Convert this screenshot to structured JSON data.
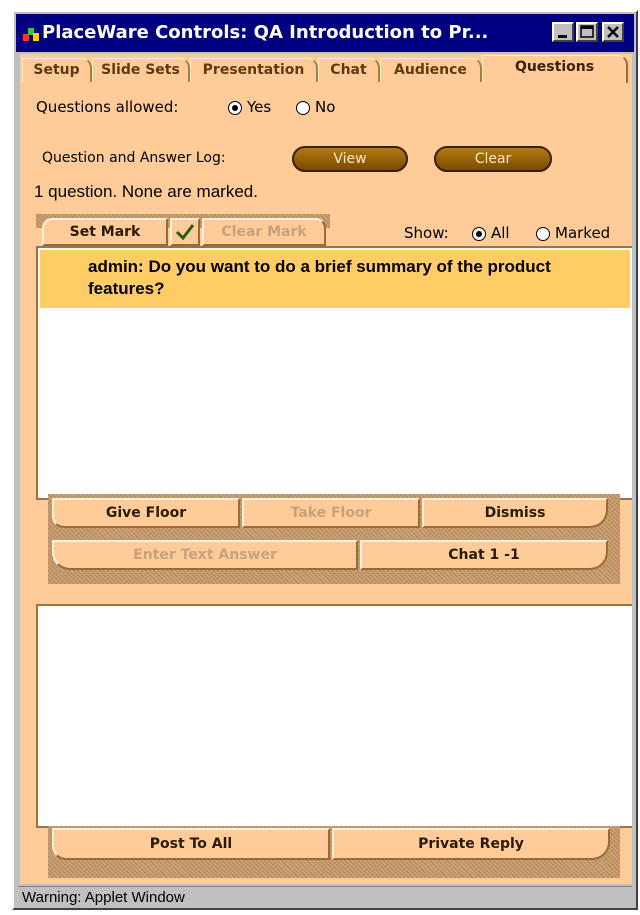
{
  "window": {
    "title": "PlaceWare Controls: QA  Introduction to Pr...",
    "icons": [
      "app-logo-icon",
      "minimize-icon",
      "maximize-icon",
      "close-icon"
    ]
  },
  "tabs": [
    {
      "label": "Setup",
      "active": false
    },
    {
      "label": "Slide Sets",
      "active": false
    },
    {
      "label": "Presentation",
      "active": false
    },
    {
      "label": "Chat",
      "active": false
    },
    {
      "label": "Audience",
      "active": false
    },
    {
      "label": "Questions",
      "active": true
    }
  ],
  "questions_allowed": {
    "label": "Questions allowed:",
    "options": [
      "Yes",
      "No"
    ],
    "selected": "Yes"
  },
  "qa_log": {
    "label": "Question and Answer Log:",
    "view_label": "View",
    "clear_label": "Clear"
  },
  "summary": "1 question. None are marked.",
  "marks": {
    "set_mark_label": "Set Mark",
    "clear_mark_label": "Clear Mark",
    "check_icon": "check-icon"
  },
  "show": {
    "label": "Show:",
    "options": [
      "All",
      "Marked"
    ],
    "selected": "All"
  },
  "question_list": [
    {
      "text": "admin: Do you want to do a brief summary of the product features?",
      "selected": true
    }
  ],
  "actions": {
    "give_floor": "Give Floor",
    "take_floor": "Take Floor",
    "dismiss": "Dismiss",
    "enter_text_answer": "Enter Text Answer",
    "chat_1_1": "Chat 1 -1"
  },
  "reply": {
    "text": "",
    "post_to_all": "Post To All",
    "private_reply": "Private Reply"
  },
  "status_text": "Warning: Applet Window",
  "colors": {
    "panel_bg": "#ffcc99",
    "title_bar": "#000080",
    "selected_row": "#ffcc66",
    "pill_button": "#8a5800"
  }
}
